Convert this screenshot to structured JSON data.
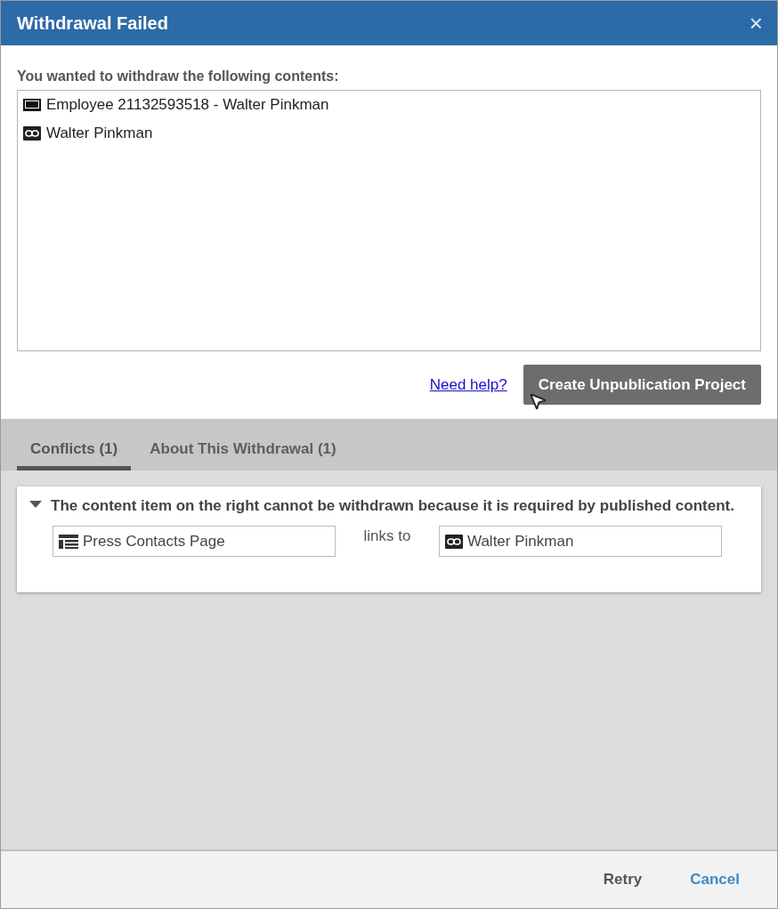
{
  "window": {
    "title": "Withdrawal Failed",
    "close": "×"
  },
  "contents": {
    "label": "You wanted to withdraw the following contents:",
    "items": [
      {
        "kind": "monitor",
        "label": "Employee 21132593518 - Walter Pinkman"
      },
      {
        "kind": "link",
        "label": "Walter Pinkman"
      }
    ]
  },
  "help_link": "Need help?",
  "primary_button": "Create Unpublication Project",
  "tabs": [
    {
      "label": "Conflicts (1)",
      "selected": true
    },
    {
      "label": "About This Withdrawal (1)",
      "selected": false
    }
  ],
  "conflicts": [
    {
      "expanded": true,
      "message": "The content item on the right cannot be withdrawn because it is required by published content.",
      "source": {
        "kind": "page",
        "label": "Press Contacts Page"
      },
      "relation": "links to",
      "target": {
        "kind": "link",
        "label": "Walter Pinkman"
      }
    }
  ],
  "footer": {
    "buttons": [
      {
        "label": "Retry",
        "kind": "secondary"
      },
      {
        "label": "Cancel",
        "kind": "primary"
      }
    ]
  }
}
